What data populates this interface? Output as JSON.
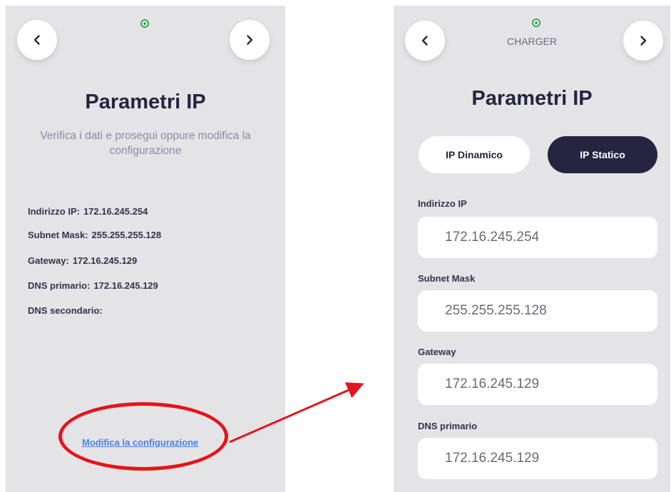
{
  "left_screen": {
    "title": "Parametri IP",
    "subtitle": "Verifica i dati e prosegui oppure modifica la configurazione",
    "params": [
      {
        "label": "Indirizzo IP:",
        "value": "172.16.245.254"
      },
      {
        "label": "Subnet Mask:",
        "value": "255.255.255.128"
      },
      {
        "label": "Gateway:",
        "value": "172.16.245.129"
      },
      {
        "label": "DNS primario:",
        "value": "172.16.245.129"
      },
      {
        "label": "DNS secondario:",
        "value": ""
      }
    ],
    "edit_link": "Modifica la configurazione"
  },
  "right_screen": {
    "header_label": "CHARGER",
    "title": "Parametri IP",
    "tabs": [
      {
        "label": "IP Dinamico",
        "selected": false
      },
      {
        "label": "IP Statico",
        "selected": true
      }
    ],
    "fields": [
      {
        "label": "Indirizzo IP",
        "value": "172.16.245.254"
      },
      {
        "label": "Subnet Mask",
        "value": "255.255.255.128"
      },
      {
        "label": "Gateway",
        "value": "172.16.245.129"
      },
      {
        "label": "DNS primario",
        "value": "172.16.245.129"
      }
    ]
  },
  "icons": {
    "back": "chevron-left-icon",
    "forward": "chevron-right-icon",
    "status": "status-dot-icon"
  },
  "colors": {
    "background": "#e4e4e6",
    "title": "#262440",
    "accent_dark": "#262440",
    "link": "#4a80e6",
    "status_green": "#2fa84f",
    "annotation_red": "#e5141c"
  }
}
